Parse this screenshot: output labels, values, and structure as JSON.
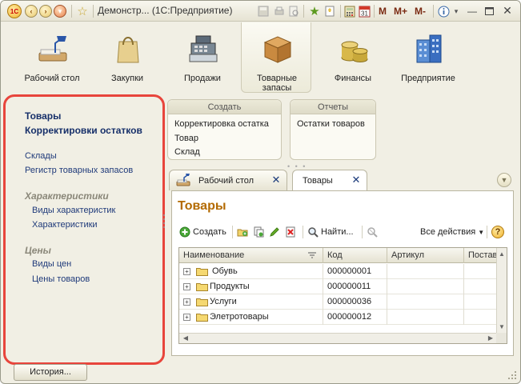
{
  "window": {
    "title": "Демонстр... (1С:Предприятие)",
    "logo": "1С"
  },
  "titlebar": {
    "icons": [
      "back-icon",
      "forward-icon",
      "favorite-star-icon",
      "calculator-icon",
      "calendar-icon",
      "info-icon"
    ],
    "memory": {
      "m": "M",
      "m_plus": "M+",
      "m_minus": "M-"
    },
    "calendar_day": "31"
  },
  "sections": [
    {
      "label": "Рабочий стол",
      "icon": "desk-lamp-icon"
    },
    {
      "label": "Закупки",
      "icon": "shopping-bag-icon"
    },
    {
      "label": "Продажи",
      "icon": "cash-register-icon"
    },
    {
      "label": "Товарные запасы",
      "icon": "box-icon"
    },
    {
      "label": "Финансы",
      "icon": "coins-icon"
    },
    {
      "label": "Предприятие",
      "icon": "building-icon"
    }
  ],
  "active_section": "Товарные запасы",
  "nav": {
    "links_top": [
      "Товары",
      "Корректировки остатков"
    ],
    "links_main": [
      "Склады",
      "Регистр товарных запасов"
    ],
    "group_characteristics": "Характеристики",
    "characteristics_items": [
      "Виды характеристик",
      "Характеристики"
    ],
    "group_prices": "Цены",
    "prices_items": [
      "Виды цен",
      "Цены товаров"
    ]
  },
  "panels": {
    "create": {
      "title": "Создать",
      "items": [
        "Корректировка остатка",
        "Товар",
        "Склад"
      ]
    },
    "reports": {
      "title": "Отчеты",
      "items": [
        "Остатки товаров"
      ]
    }
  },
  "tabs": [
    {
      "label": "Рабочий стол",
      "icon": "desk-lamp-icon"
    },
    {
      "label": "Товары"
    }
  ],
  "form": {
    "title": "Товары",
    "commands": {
      "create": "Создать",
      "find": "Найти...",
      "all_actions": "Все действия",
      "help": "?"
    },
    "columns": [
      "Наименование",
      "Код",
      "Артикул",
      "Постав"
    ],
    "rows": [
      {
        "name": "Обувь",
        "code": "000000001",
        "article": ""
      },
      {
        "name": "Продукты",
        "code": "000000011",
        "article": ""
      },
      {
        "name": "Услуги",
        "code": "000000036",
        "article": ""
      },
      {
        "name": "Элетротовары",
        "code": "000000012",
        "article": ""
      }
    ]
  },
  "footer": {
    "history_label": "История..."
  },
  "colors": {
    "accent": "#b36a00",
    "link": "#1f3a7a",
    "highlight": "#e8453c",
    "selection": "#316ac5"
  }
}
